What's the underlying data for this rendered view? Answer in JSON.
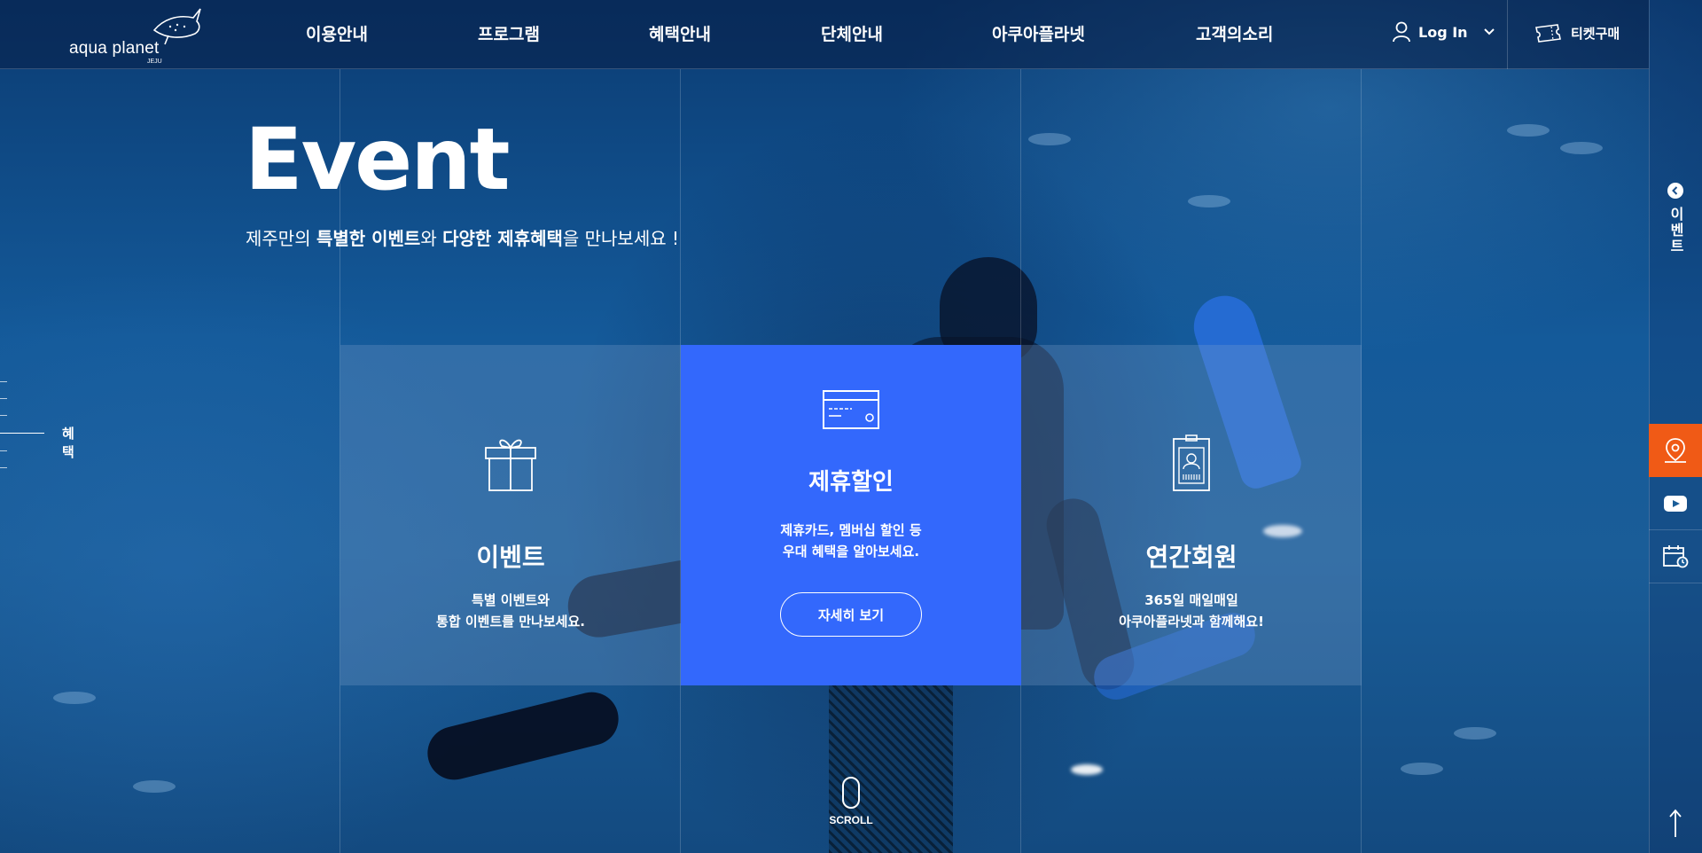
{
  "brand": {
    "logo_text": "aqua planet",
    "logo_sub": "JEJU"
  },
  "nav": {
    "items": [
      {
        "label": "이용안내"
      },
      {
        "label": "프로그램"
      },
      {
        "label": "혜택안내"
      },
      {
        "label": "단체안내"
      },
      {
        "label": "아쿠아플라넷"
      },
      {
        "label": "고객의소리"
      }
    ],
    "login_label": "Log In",
    "ticket_label": "티켓구매"
  },
  "hero": {
    "title": "Event",
    "subtitle_parts": [
      "제주만의 ",
      "특별한 이벤트",
      "와 ",
      "다양한 제휴혜택",
      "을 만나보세요 !"
    ]
  },
  "indicator": {
    "active_label": "혜택"
  },
  "cards": [
    {
      "title": "이벤트",
      "desc_line1": "특별 이벤트와",
      "desc_line2": "통합 이벤트를 만나보세요.",
      "icon": "gift-icon"
    },
    {
      "title": "제휴할인",
      "desc_line1": "제휴카드, 멤버십 할인 등",
      "desc_line2": "우대 혜택을 알아보세요.",
      "button_label": "자세히 보기",
      "icon": "credit-card-icon"
    },
    {
      "title": "연간회원",
      "desc_line1": "365일 매일매일",
      "desc_line2": "아쿠아플라넷과 함께해요!",
      "icon": "member-card-icon"
    }
  ],
  "sidebar": {
    "event_label": "이벤트",
    "buttons": [
      {
        "icon": "map-pin-icon"
      },
      {
        "icon": "youtube-icon"
      },
      {
        "icon": "calendar-icon"
      }
    ]
  },
  "scroll_label": "SCROLL",
  "colors": {
    "accent_blue": "#3368fc",
    "accent_orange": "#f05a16"
  }
}
